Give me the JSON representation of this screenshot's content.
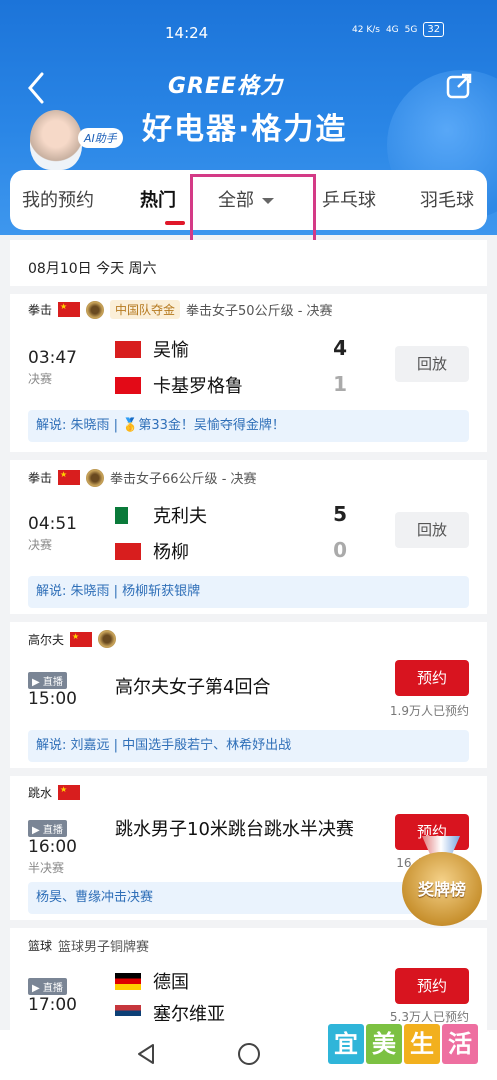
{
  "status_bar": {
    "time": "14:24",
    "net_speed": "42 K/s",
    "signal1": "4G",
    "signal2": "5G",
    "battery": "32"
  },
  "header": {
    "brand": "GREE格力",
    "slogan": "好电器·格力造",
    "ai_badge": "AI助手"
  },
  "tabs": [
    {
      "label": "我的预约"
    },
    {
      "label": "热门"
    },
    {
      "label": "全部"
    },
    {
      "label": "乒乓球"
    },
    {
      "label": "羽毛球"
    }
  ],
  "date_row": "08月10日 今天 周六",
  "events": [
    {
      "sport": "拳击",
      "gold_tag": "中国队夺金",
      "title": "拳击女子50公斤级 - 决赛",
      "time": "03:47",
      "stage": "决赛",
      "team1": "吴愉",
      "score1": "4",
      "team2": "卡基罗格鲁",
      "score2": "1",
      "button": "回放",
      "commentary": "解说: 朱晓雨 | 🥇第33金！吴愉夺得金牌！"
    },
    {
      "sport": "拳击",
      "title": "拳击女子66公斤级 - 决赛",
      "time": "04:51",
      "stage": "决赛",
      "team1": "克利夫",
      "score1": "5",
      "team2": "杨柳",
      "score2": "0",
      "button": "回放",
      "commentary": "解说: 朱晓雨 | 杨柳斩获银牌"
    },
    {
      "sport": "高尔夫",
      "live": "直播",
      "time": "15:00",
      "title": "高尔夫女子第4回合",
      "button": "预约",
      "reserve_count": "1.9万人已预约",
      "commentary": "解说: 刘嘉远 | 中国选手殷若宁、林希妤出战"
    },
    {
      "sport": "跳水",
      "live": "直播",
      "time": "16:00",
      "stage": "半决赛",
      "title": "跳水男子10米跳台跳水半决赛",
      "button": "预约",
      "reserve_count": "16.4",
      "commentary": "杨昊、曹缘冲击决赛"
    },
    {
      "sport": "篮球",
      "title": "篮球男子铜牌赛",
      "live": "直播",
      "time": "17:00",
      "team1": "德国",
      "team2": "塞尔维亚",
      "button": "预约",
      "reserve_count": "5.3万人已预约"
    }
  ],
  "medal_widget": {
    "label": "奖牌榜"
  },
  "watermark": [
    "宜",
    "美",
    "生",
    "活"
  ],
  "colors": {
    "header_blue": "#1c74d9",
    "reserve_red": "#d8141f",
    "commentary_blue": "#2f6fb8",
    "highlight_pink": "#d43a86"
  }
}
